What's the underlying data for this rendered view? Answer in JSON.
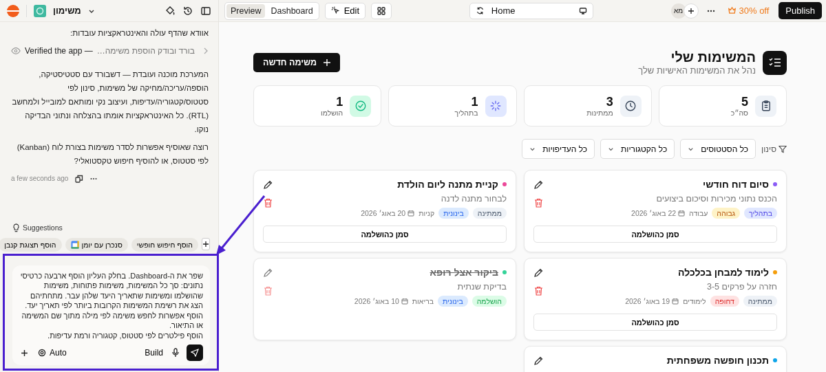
{
  "app": {
    "name": "משימון"
  },
  "toolbar": {
    "view_tabs": [
      {
        "label": "Dashboard",
        "selected": false
      },
      {
        "label": "Preview",
        "selected": true
      }
    ],
    "edit_label": "Edit",
    "address": "Home",
    "avatar": "מא",
    "promo": "30% off",
    "publish": "Publish"
  },
  "chat": {
    "messages": [
      {
        "kind": "text",
        "text": "אוודא שהדף עולה והאינטראקציות עובדות:"
      },
      {
        "kind": "step",
        "label": "Verified the app —",
        "detail": "בורד ובודק הוספת משימה…"
      },
      {
        "kind": "text",
        "text": "המערכת מוכנה ועובדת — דשבורד עם סטטיסטיקה, הוספה/עריכה/מחיקה של משימות, סינון לפי סטטוס/קטגוריה/עדיפות, ועיצוב נקי ומותאם למובייל ולמחשב (RTL). כל האינטראקציות אומתו בהצלחה ונתוני הבדיקה נוקו."
      },
      {
        "kind": "text",
        "text": "רוצה שאוסיף אפשרות לסדר משימות בצורת לוח (Kanban) לפי סטטוס, או להוסיף חיפוש טקסטואלי?"
      }
    ],
    "timestamp": "a few seconds ago",
    "suggestions_label": "Suggestions",
    "suggestions": [
      {
        "label": "הוסף חיפוש חופשי",
        "kind": "plain"
      },
      {
        "label": "סנכרן עם יומן",
        "kind": "calendar"
      },
      {
        "label": "הוסף תצוגת קנבן",
        "kind": "plain"
      }
    ],
    "composer": {
      "value": "שפר את ה-Dashboard. בחלק העליון הוסף ארבעה כרטיסי נתונים: סך כל המשימות, משימות פתוחות, משימות שהושלמו ומשימות שתאריך היעד שלהן עבר. מתחתיהם הצג את רשימת המשימות הקרובות ביותר לפי תאריך יעד.\nהוסף אפשרות לחפש משימה לפי מילה מתוך שם המשימה או התיאור.\nהוסף פילטרים לפי סטטוס, קטגוריה ורמת עדיפות.",
      "mode": "Auto",
      "build": "Build"
    }
  },
  "page": {
    "title": "המשימות שלי",
    "subtitle": "נהל את המשימות האישיות שלך",
    "new_task": "משימה חדשה",
    "stats": [
      {
        "kind": "total",
        "value": "5",
        "label": "סה״כ"
      },
      {
        "kind": "pending",
        "value": "3",
        "label": "ממתינות"
      },
      {
        "kind": "in_progress",
        "value": "1",
        "label": "בתהליך"
      },
      {
        "kind": "done",
        "value": "1",
        "label": "הושלמו"
      }
    ],
    "filter_label": "סינון",
    "filters": [
      "כל הסטטוסים",
      "כל הקטגוריות",
      "כל העדיפויות"
    ],
    "tasks": [
      {
        "title": "סיום דוח חודשי",
        "color": "#8b5cf6",
        "description": "הכנס נתוני מכירות וסיכום ביצועים",
        "status": {
          "kind": "in_progress",
          "label": "בתהליך"
        },
        "priority": {
          "kind": "high",
          "label": "גבוהה"
        },
        "category": "עבודה",
        "date": "22 באוג׳ 2026",
        "completed": false,
        "action": "סמן כהושלמה"
      },
      {
        "title": "קניית מתנה ליום הולדת",
        "color": "#ec4899",
        "description": "לבחור מתנה לדנה",
        "status": {
          "kind": "pending",
          "label": "ממתינה"
        },
        "priority": {
          "kind": "medium",
          "label": "בינונית"
        },
        "category": "קניות",
        "date": "20 באוג׳ 2026",
        "completed": false,
        "action": "סמן כהושלמה"
      },
      {
        "title": "לימוד למבחן בכלכלה",
        "color": "#f59e0b",
        "description": "חזרה על פרקים 3-5",
        "status": {
          "kind": "pending",
          "label": "ממתינה"
        },
        "priority": {
          "kind": "urgent",
          "label": "דחופה"
        },
        "category": "לימודים",
        "date": "19 באוג׳ 2026",
        "completed": false,
        "action": "סמן כהושלמה"
      },
      {
        "title": "ביקור אצל רופא",
        "color": "#34d399",
        "description": "בדיקת שנתית",
        "status": {
          "kind": "done",
          "label": "הושלמה"
        },
        "priority": {
          "kind": "medium",
          "label": "בינונית"
        },
        "category": "בריאות",
        "date": "10 באוג׳ 2026",
        "completed": true
      },
      {
        "title": "תכנון חופשה משפחתית",
        "color": "#0ea5e9",
        "completed": false
      }
    ]
  }
}
